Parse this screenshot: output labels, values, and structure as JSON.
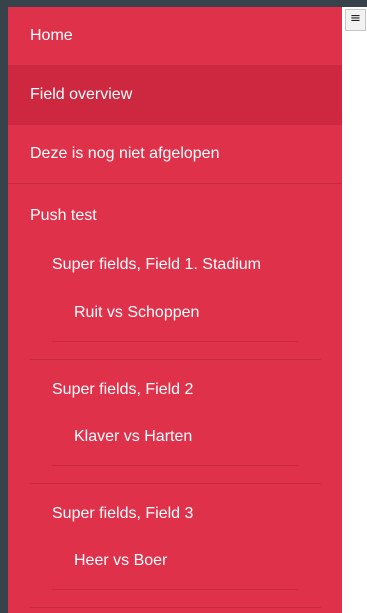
{
  "toggle": {
    "glyph": "≡"
  },
  "nav": {
    "items": [
      {
        "label": "Home"
      },
      {
        "label": "Field overview"
      },
      {
        "label": "Deze is nog niet afgelopen"
      }
    ]
  },
  "push_test": {
    "title": "Push test",
    "fields": [
      {
        "name": "Super fields, Field 1. Stadium",
        "match": "Ruit vs Schoppen"
      },
      {
        "name": "Super fields, Field 2",
        "match": "Klaver vs Harten"
      },
      {
        "name": "Super fields, Field 3",
        "match": "Heer vs Boer"
      }
    ]
  }
}
